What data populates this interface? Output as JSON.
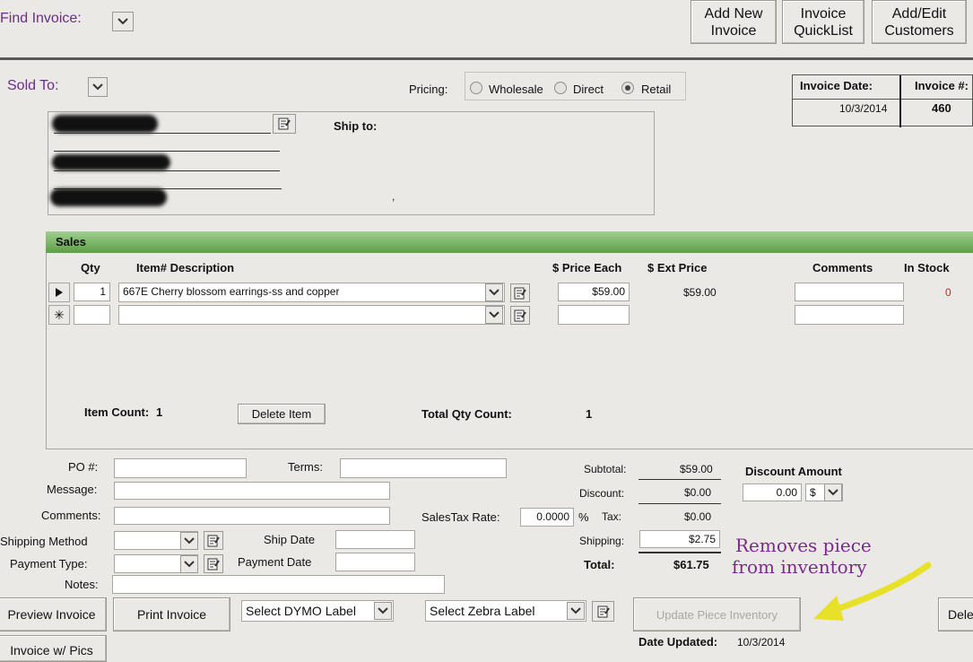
{
  "header": {
    "find_invoice_label": "Find Invoice:",
    "add_new_invoice": [
      "Add New",
      "Invoice"
    ],
    "invoice_quicklist": [
      "Invoice",
      "QuickList"
    ],
    "add_edit_customers": [
      "Add/Edit",
      "Customers"
    ]
  },
  "customer": {
    "sold_to_label": "Sold To:",
    "pricing_label": "Pricing:",
    "pricing_options": [
      "Wholesale",
      "Direct",
      "Retail"
    ],
    "pricing_selected": "Retail",
    "ship_to_label": "Ship to:",
    "ship_to_mark": ","
  },
  "invoice_info": {
    "date_label": "Invoice Date:",
    "number_label": "Invoice #:",
    "date_value": "10/3/2014",
    "number_value": "460"
  },
  "sales": {
    "section_title": "Sales",
    "columns": {
      "qty": "Qty",
      "item_desc": "Item#  Description",
      "price_each": "$ Price Each",
      "ext_price": "$ Ext Price",
      "comments": "Comments",
      "in_stock": "In Stock"
    },
    "rows": [
      {
        "qty": "1",
        "item": "667E   Cherry blossom earrings-ss and copper",
        "price_each": "$59.00",
        "ext_price": "$59.00",
        "comments": "",
        "in_stock": "0"
      }
    ],
    "item_count_label": "Item Count:",
    "item_count": "1",
    "delete_item": "Delete Item",
    "total_qty_label": "Total Qty Count:",
    "total_qty": "1"
  },
  "details": {
    "po_label": "PO #:",
    "terms_label": "Terms:",
    "message_label": "Message:",
    "comments_label": "Comments:",
    "shipping_method_label": "Shipping Method",
    "payment_type_label": "Payment Type:",
    "notes_label": "Notes:",
    "ship_date_label": "Ship Date",
    "payment_date_label": "Payment Date",
    "sales_tax_rate_label": "SalesTax Rate:",
    "sales_tax_rate": "0.0000",
    "percent": "%"
  },
  "totals": {
    "subtotal_label": "Subtotal:",
    "subtotal": "$59.00",
    "discount_label": "Discount:",
    "discount": "$0.00",
    "tax_label": "Tax:",
    "tax": "$0.00",
    "shipping_label": "Shipping:",
    "shipping": "$2.75",
    "total_label": "Total:",
    "total": "$61.75",
    "discount_amount_label": "Discount Amount",
    "discount_amount": "0.00",
    "discount_type": "$"
  },
  "footer": {
    "preview_invoice": "Preview Invoice",
    "print_invoice": "Print Invoice",
    "dymo_label": "Select DYMO Label",
    "zebra_label": "Select Zebra Label",
    "update_inventory": "Update Piece Inventory",
    "delete_cut": "Dele",
    "invoice_pics": "Invoice w/ Pics",
    "date_updated_label": "Date Updated:",
    "date_updated": "10/3/2014"
  },
  "annotation": {
    "line1": "Removes piece",
    "line2": "from inventory",
    "color": "#e8e12a"
  }
}
